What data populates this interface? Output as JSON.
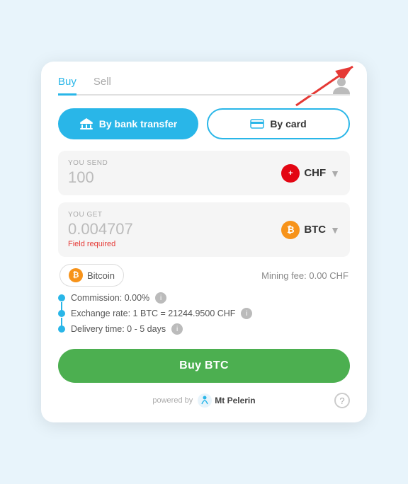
{
  "tabs": [
    {
      "label": "Buy",
      "active": true
    },
    {
      "label": "Sell",
      "active": false
    }
  ],
  "payment": {
    "bank_label": "By bank transfer",
    "card_label": "By card"
  },
  "send": {
    "label": "YOU SEND",
    "value": "100",
    "currency": "CHF",
    "currency_symbol": "+"
  },
  "get": {
    "label": "YOU GET",
    "value": "0.004707",
    "currency": "BTC",
    "field_required": "Field required"
  },
  "coin": {
    "name": "Bitcoin",
    "mining_fee": "Mining fee: 0.00 CHF"
  },
  "details": [
    {
      "label": "Commission: 0.00%",
      "has_info": true
    },
    {
      "label": "Exchange rate: 1 BTC = 21244.9500 CHF",
      "has_info": true
    },
    {
      "label": "Delivery time: 0 - 5 days",
      "has_info": true
    }
  ],
  "buy_button": "Buy BTC",
  "footer": {
    "powered_by": "powered by",
    "brand": "Mt\nPelerin"
  }
}
